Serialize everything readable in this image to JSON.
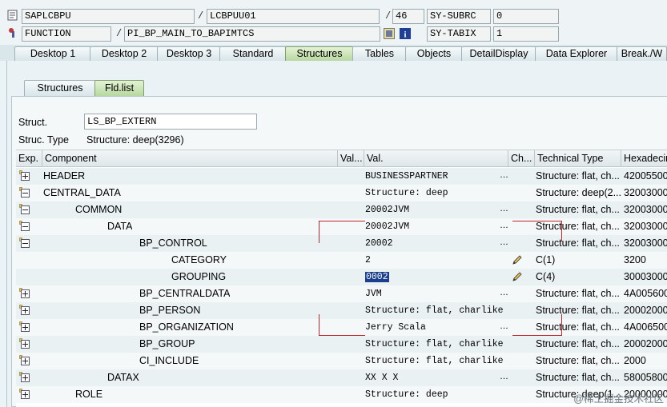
{
  "header": {
    "program": "SAPLCBPU",
    "include": "LCBPUU01",
    "line": "46",
    "subrc_label": "SY-SUBRC",
    "subrc_value": "0",
    "event_type": "FUNCTION",
    "event_name": "PI_BP_MAIN_TO_BAPIMTCS",
    "tabix_label": "SY-TABIX",
    "tabix_value": "1",
    "sep1": "/",
    "sep2": "/",
    "sep3": "/"
  },
  "tabs": [
    {
      "label": "Desktop 1"
    },
    {
      "label": "Desktop 2"
    },
    {
      "label": "Desktop 3"
    },
    {
      "label": "Standard"
    },
    {
      "label": "Structures"
    },
    {
      "label": "Tables"
    },
    {
      "label": "Objects"
    },
    {
      "label": "DetailDisplay"
    },
    {
      "label": "Data Explorer"
    },
    {
      "label": "Break./W"
    }
  ],
  "subtabs": [
    {
      "label": "Structures"
    },
    {
      "label": "Fld.list"
    }
  ],
  "struct": {
    "label": "Struct.",
    "value": "LS_BP_EXTERN",
    "type_label": "Struc. Type",
    "type_value": "Structure: deep(3296)"
  },
  "columns": {
    "exp": "Exp.",
    "component": "Component",
    "val_short": "Val...",
    "val": "Val.",
    "ch": "Ch...",
    "tech": "Technical Type",
    "hex": "Hexadecim"
  },
  "rows": [
    {
      "component": "HEADER",
      "val": "BUSINESSPARTNER",
      "dots": "…",
      "tech": "Structure: flat, ch...",
      "hex": "42005500",
      "icon": "plus"
    },
    {
      "component": "CENTRAL_DATA",
      "val": "Structure: deep",
      "dots": "",
      "tech": "Structure: deep(2...",
      "hex": "32003000",
      "icon": "minus"
    },
    {
      "component": "COMMON",
      "val": "20002JVM",
      "dots": "…",
      "tech": "Structure: flat, ch...",
      "hex": "32003000",
      "icon": "minus"
    },
    {
      "component": "DATA",
      "val": "20002JVM",
      "dots": "…",
      "tech": "Structure: flat, ch...",
      "hex": "32003000",
      "icon": "minus"
    },
    {
      "component": "BP_CONTROL",
      "val": "20002",
      "dots": "…",
      "tech": "Structure: flat, ch...",
      "hex": "32003000",
      "icon": "minus"
    },
    {
      "component": "CATEGORY",
      "val": "2",
      "dots": "",
      "tech": "C(1)",
      "hex": "3200",
      "icon": "",
      "pencil": true
    },
    {
      "component": "GROUPING",
      "val": "0002",
      "dots": "",
      "tech": "C(4)",
      "hex": "30003000",
      "icon": "",
      "pencil": true,
      "selected": true
    },
    {
      "component": "BP_CENTRALDATA",
      "val": "JVM",
      "dots": "…",
      "tech": "Structure: flat, ch...",
      "hex": "4A005600",
      "icon": "plus"
    },
    {
      "component": "BP_PERSON",
      "val": "Structure: flat, charlike",
      "dots": "",
      "tech": "Structure: flat, ch...",
      "hex": "20002000",
      "icon": "plus"
    },
    {
      "component": "BP_ORGANIZATION",
      "val": "Jerry Scala",
      "dots": "…",
      "tech": "Structure: flat, ch...",
      "hex": "4A006500",
      "icon": "plus"
    },
    {
      "component": "BP_GROUP",
      "val": "Structure: flat, charlike",
      "dots": "",
      "tech": "Structure: flat, ch...",
      "hex": "20002000",
      "icon": "plus"
    },
    {
      "component": "CI_INCLUDE",
      "val": "Structure: flat, charlike",
      "dots": "",
      "tech": "Structure: flat, ch...",
      "hex": "2000",
      "icon": "plus"
    },
    {
      "component": "DATAX",
      "val": "XX     X X",
      "dots": "…",
      "tech": "Structure: flat, ch...",
      "hex": "58005800",
      "icon": "plus"
    },
    {
      "component": "ROLE",
      "val": "Structure: deep",
      "dots": "",
      "tech": "Structure: deep(1...",
      "hex": "20000000",
      "icon": "plus"
    }
  ],
  "watermark": "@稀土掘金技术社区",
  "colors": {
    "selection": "#1a3f8f",
    "annotation_red": "#c0262d",
    "active_tab": "#b7d8a0"
  }
}
